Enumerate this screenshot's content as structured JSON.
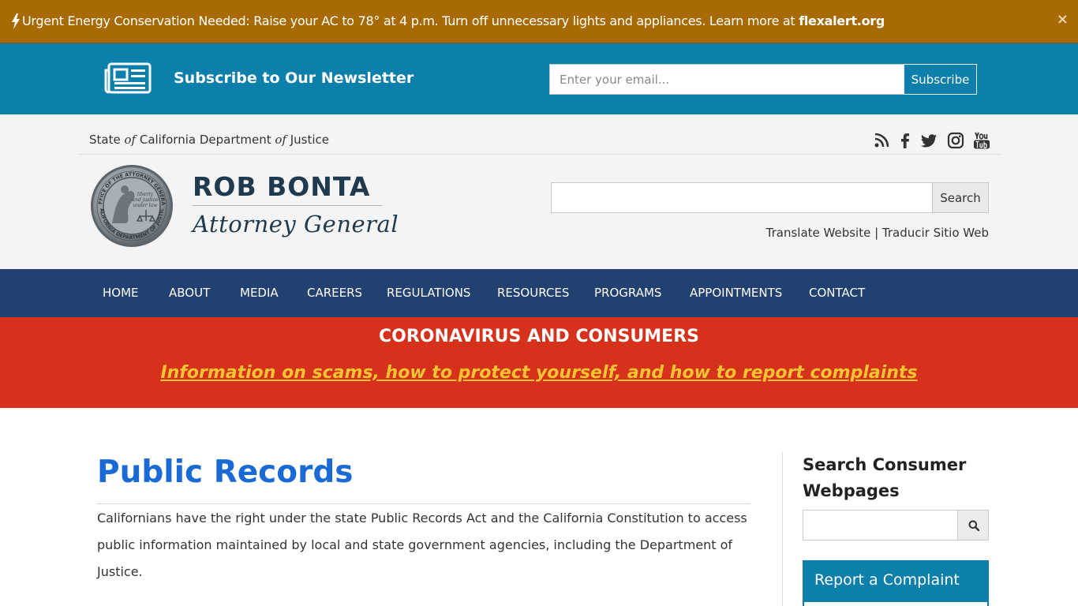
{
  "alert": {
    "message": "Urgent Energy Conservation Needed: Raise your AC to 78° at 4 p.m. Turn off unnecessary lights and appliances. Learn more at ",
    "link": "flexalert.org",
    "close": "×",
    "bolt_icon": "bolt-icon"
  },
  "newsletter": {
    "icon": "newspaper-icon",
    "title": "Subscribe to Our Newsletter",
    "email_placeholder": "Enter your email...",
    "button": "Subscribe"
  },
  "header": {
    "state_part1": "State ",
    "state_of1": "of",
    "state_part2": " California Department ",
    "state_of2": "of",
    "state_part3": " Justice",
    "social_icons": [
      "rss-icon",
      "facebook-icon",
      "twitter-icon",
      "instagram-icon",
      "youtube-icon"
    ],
    "seal_icon": "california-doj-seal",
    "name": "ROB BONTA",
    "subtitle": "Attorney General",
    "search_button": "Search",
    "translate_en": "Translate Website",
    "translate_sep": " | ",
    "translate_es": "Traducir Sitio Web"
  },
  "nav": {
    "items": [
      "HOME",
      "ABOUT",
      "MEDIA",
      "CAREERS",
      "REGULATIONS",
      "RESOURCES",
      "PROGRAMS",
      "APPOINTMENTS",
      "CONTACT"
    ]
  },
  "covid": {
    "heading": "CORONAVIRUS AND CONSUMERS",
    "link": "Information on scams, how to protect yourself, and how to report complaints"
  },
  "main": {
    "title": "Public Records",
    "intro": "Californians have the right under the state Public Records Act and the California Constitution to access public information maintained by local and state government agencies, including the Department of Justice."
  },
  "sidebar": {
    "search_title": "Search Consumer Webpages",
    "search_icon": "search-icon",
    "complaint": "Report a Complaint"
  },
  "colors": {
    "alert_bg": "#a86a04",
    "newsletter_bg": "#0d7fab",
    "nav_bg": "#234170",
    "covid_bg": "#d6321b",
    "covid_link": "#f6c433",
    "title_blue": "#1a6ad6"
  }
}
